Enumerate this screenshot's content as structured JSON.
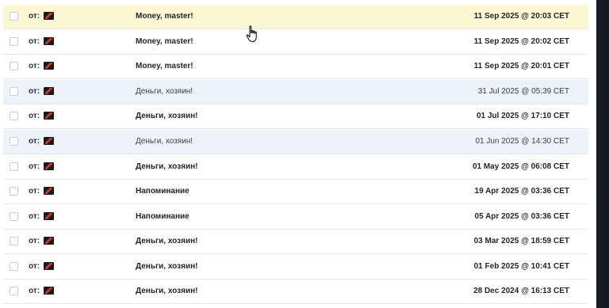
{
  "from_label": "от:",
  "messages": [
    {
      "subject": "Money, master!",
      "date": "11 Sep 2025 @ 20:03 CET"
    },
    {
      "subject": "Money, master!",
      "date": "11 Sep 2025 @ 20:02 CET"
    },
    {
      "subject": "Money, master!",
      "date": "11 Sep 2025 @ 20:01 CET"
    },
    {
      "subject": "Деньги, хозяин!",
      "date": "31 Jul 2025 @ 05:39 CET"
    },
    {
      "subject": "Деньги, хозяин!",
      "date": "01 Jul 2025 @ 17:10 CET"
    },
    {
      "subject": "Деньги, хозяин!",
      "date": "01 Jun 2025 @ 14:30 CET"
    },
    {
      "subject": "Деньги, хозяин!",
      "date": "01 May 2025 @ 06:08 CET"
    },
    {
      "subject": "Напоминание",
      "date": "19 Apr 2025 @ 03:36 CET"
    },
    {
      "subject": "Напоминание",
      "date": "05 Apr 2025 @ 03:36 CET"
    },
    {
      "subject": "Деньги, хозяин!",
      "date": "03 Mar 2025 @ 18:59 CET"
    },
    {
      "subject": "Деньги, хозяин!",
      "date": "01 Feb 2025 @ 10:41 CET"
    },
    {
      "subject": "Деньги, хозяин!",
      "date": "28 Dec 2024 @ 16:13 CET"
    }
  ],
  "colors": {
    "hover_row": "#fbf7d2",
    "read_row": "#eef3f9",
    "unread_row": "#ffffff"
  }
}
